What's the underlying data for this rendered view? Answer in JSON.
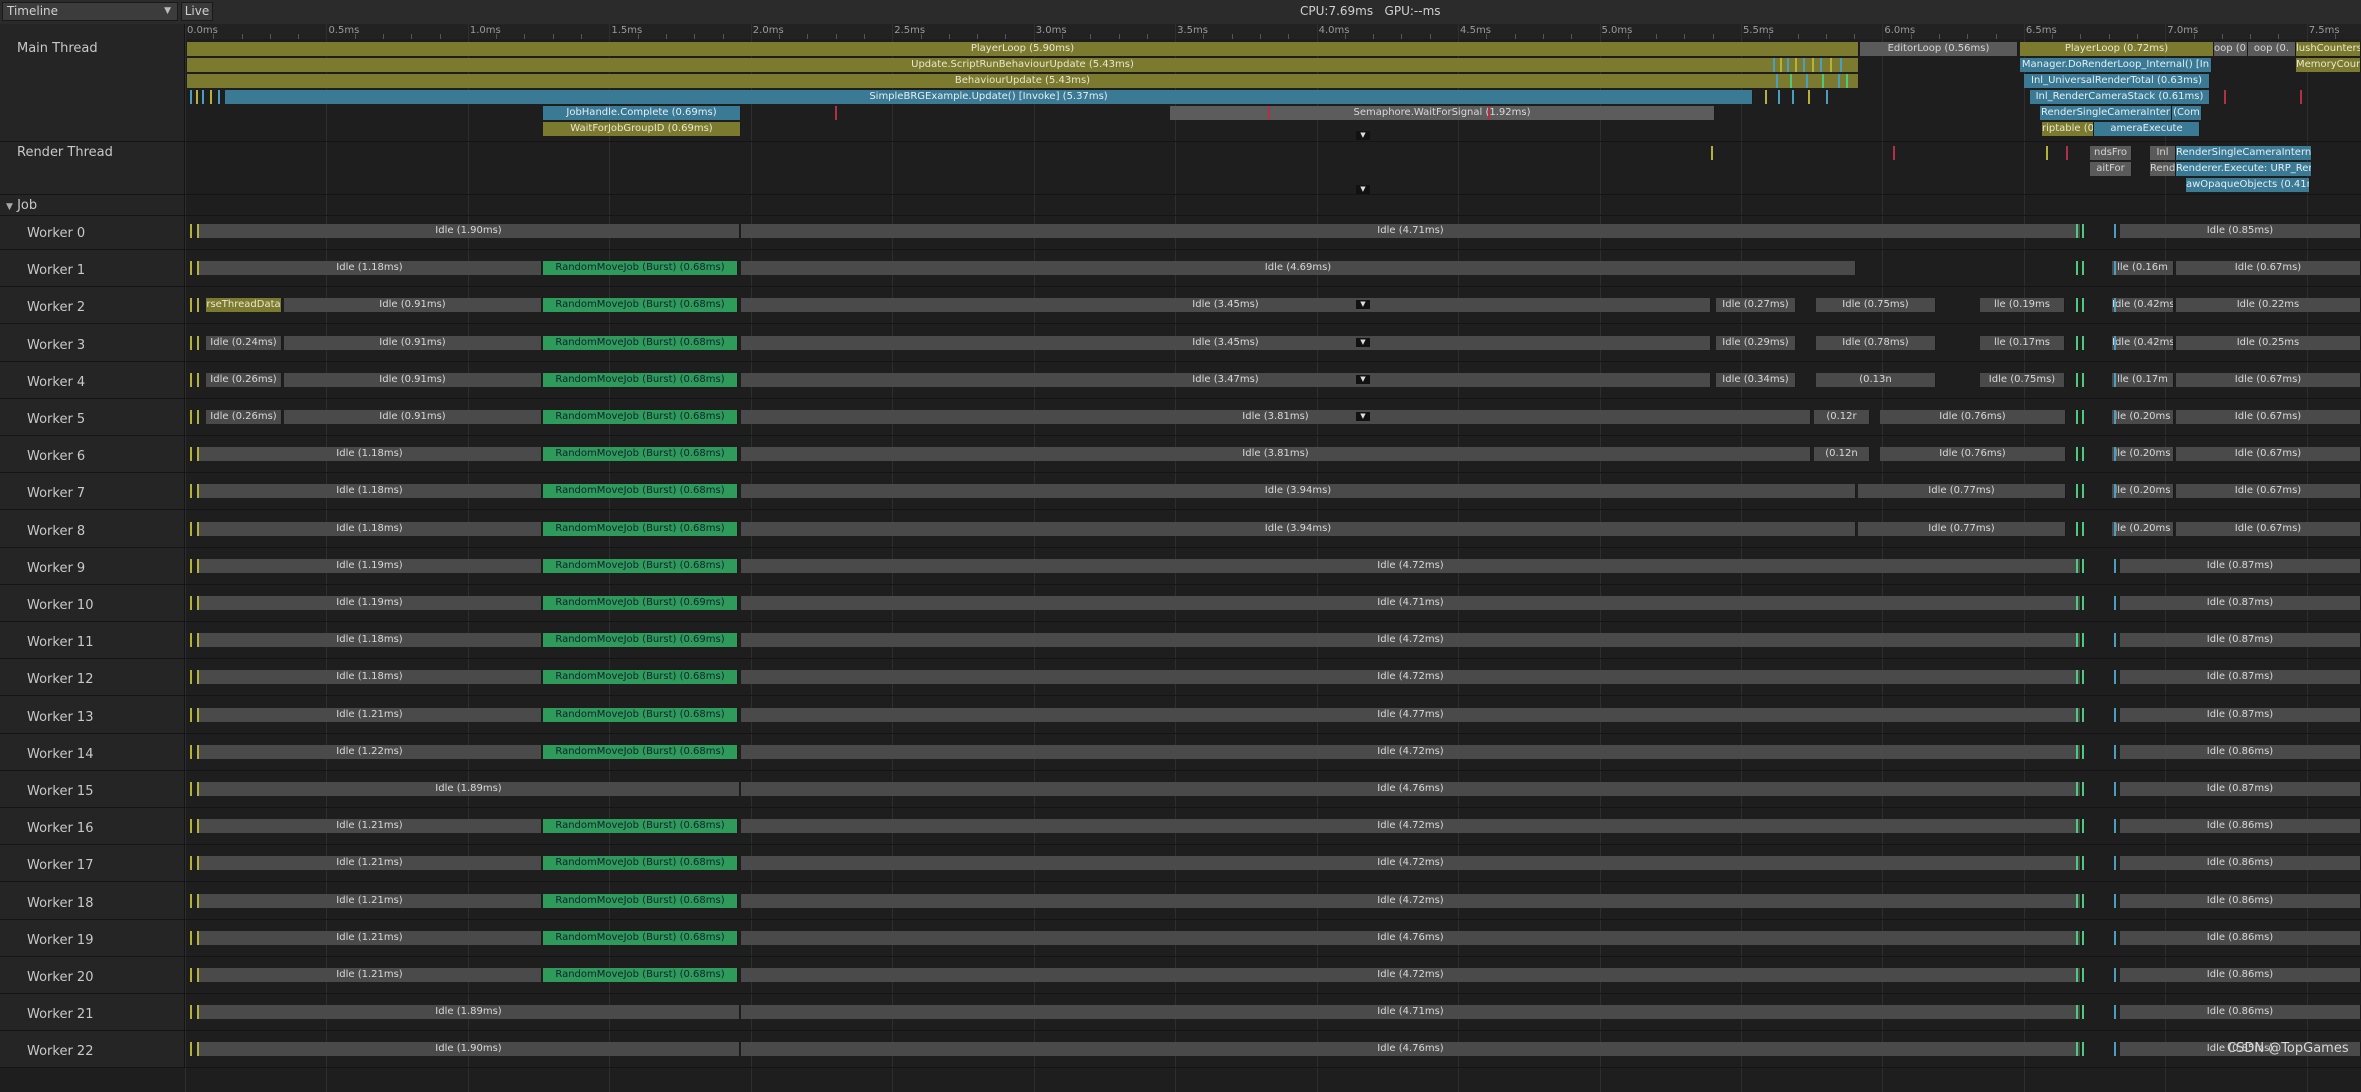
{
  "toolbar": {
    "view_select": "Timeline",
    "live_label": "Live",
    "cpu_gpu": "CPU:7.69ms   GPU:--ms"
  },
  "ruler": {
    "ticks": [
      "0.0ms",
      "0.5ms",
      "1.0ms",
      "1.5ms",
      "2.0ms",
      "2.5ms",
      "3.0ms",
      "3.5ms",
      "4.0ms",
      "4.5ms",
      "5.0ms",
      "5.5ms",
      "6.0ms",
      "6.5ms",
      "7.0ms",
      "7.5ms"
    ]
  },
  "threads": {
    "main": "Main Thread",
    "render": "Render Thread",
    "job_group": "Job"
  },
  "main_thread_markers": {
    "player_loop": "PlayerLoop (5.90ms)",
    "update_script": "Update.ScriptRunBehaviourUpdate (5.43ms)",
    "behaviour_update": "BehaviourUpdate (5.43ms)",
    "example_update": "SimpleBRGExample.Update() [Invoke] (5.37ms)",
    "job_complete": "JobHandle.Complete (0.69ms)",
    "wait_for_job": "WaitForJobGroupID (0.69ms)",
    "semaphore_wait": "Semaphore.WaitForSignal (1.92ms)",
    "editor_loop": "EditorLoop (0.56ms)",
    "player_loop_2": "PlayerLoop (0.72ms)",
    "frag_loop": "oop (0.",
    "frag_loop_2": "oop (0.",
    "flush_counters": "lushCounters",
    "render_loop_internal": "Manager.DoRenderLoop_Internal() [In",
    "memory_counters": "MemoryCoun",
    "urp_render_total": "Inl_UniversalRenderTotal (0.63ms)",
    "render_camera_stack": "Inl_RenderCameraStack (0.61ms)",
    "render_single_camera": "RenderSingleCameraInter",
    "frag_comp": "(Com",
    "scriptable": "riptable (0.",
    "frag_execute": "ameraExecute"
  },
  "render_thread_markers": {
    "frag_sends": "ndsFro",
    "frag_inl": "Inl",
    "render_single_internal": "RenderSingleCameraInterna",
    "frag_wait": "aitFor",
    "frag_rend": "Rend",
    "renderer_execute": "Renderer.Execute: URP_Rende",
    "opaque_objects": "awOpaqueObjects (0.41n"
  },
  "workers": [
    {
      "name": "Worker 0",
      "bars": [
        "Idle (1.90ms)",
        "Idle (4.71ms)",
        "Idle (0.85ms)"
      ]
    },
    {
      "name": "Worker 1",
      "bars": [
        "Idle (1.18ms)",
        "RandomMoveJob (Burst) (0.68ms)",
        "Idle (4.69ms)",
        "lle (0.16m",
        "Idle (0.67ms)"
      ]
    },
    {
      "name": "Worker 2",
      "bars": [
        "rseThreadData",
        "Idle (0.91ms)",
        "RandomMoveJob (Burst) (0.68ms)",
        "Idle (3.45ms)",
        "Idle (0.27ms)",
        "Idle (0.75ms)",
        "lle (0.19ms",
        "Idle (0.42ms)",
        "Idle (0.22ms"
      ]
    },
    {
      "name": "Worker 3",
      "bars": [
        "Idle (0.24ms)",
        "Idle (0.91ms)",
        "RandomMoveJob (Burst) (0.68ms)",
        "Idle (3.45ms)",
        "Idle (0.29ms)",
        "Idle (0.78ms)",
        "lle (0.17ms",
        "Idle (0.42ms)",
        "Idle (0.25ms"
      ]
    },
    {
      "name": "Worker 4",
      "bars": [
        "Idle (0.26ms)",
        "Idle (0.91ms)",
        "RandomMoveJob (Burst) (0.68ms)",
        "Idle (3.47ms)",
        "Idle (0.34ms)",
        "(0.13n",
        "Idle (0.75ms)",
        "lle (0.17m",
        "Idle (0.67ms)"
      ]
    },
    {
      "name": "Worker 5",
      "bars": [
        "Idle (0.26ms)",
        "Idle (0.91ms)",
        "RandomMoveJob (Burst) (0.68ms)",
        "Idle (3.81ms)",
        "(0.12r",
        "Idle (0.76ms)",
        "lle (0.20ms",
        "Idle (0.67ms)"
      ]
    },
    {
      "name": "Worker 6",
      "bars": [
        "Idle (1.18ms)",
        "RandomMoveJob (Burst) (0.68ms)",
        "Idle (3.81ms)",
        "(0.12n",
        "Idle (0.76ms)",
        "lle (0.20ms",
        "Idle (0.67ms)"
      ]
    },
    {
      "name": "Worker 7",
      "bars": [
        "Idle (1.18ms)",
        "RandomMoveJob (Burst) (0.68ms)",
        "Idle (3.94ms)",
        "Idle (0.77ms)",
        "lle (0.20ms",
        "Idle (0.67ms)"
      ]
    },
    {
      "name": "Worker 8",
      "bars": [
        "Idle (1.18ms)",
        "RandomMoveJob (Burst) (0.68ms)",
        "Idle (3.94ms)",
        "Idle (0.77ms)",
        "lle (0.20ms",
        "Idle (0.67ms)"
      ]
    },
    {
      "name": "Worker 9",
      "bars": [
        "Idle (1.19ms)",
        "RandomMoveJob (Burst) (0.68ms)",
        "Idle (4.72ms)",
        "Idle (0.87ms)"
      ]
    },
    {
      "name": "Worker 10",
      "bars": [
        "Idle (1.19ms)",
        "RandomMoveJob (Burst) (0.69ms)",
        "Idle (4.71ms)",
        "Idle (0.87ms)"
      ]
    },
    {
      "name": "Worker 11",
      "bars": [
        "Idle (1.18ms)",
        "RandomMoveJob (Burst) (0.69ms)",
        "Idle (4.72ms)",
        "Idle (0.87ms)"
      ]
    },
    {
      "name": "Worker 12",
      "bars": [
        "Idle (1.18ms)",
        "RandomMoveJob (Burst) (0.68ms)",
        "Idle (4.72ms)",
        "Idle (0.87ms)"
      ]
    },
    {
      "name": "Worker 13",
      "bars": [
        "Idle (1.21ms)",
        "RandomMoveJob (Burst) (0.68ms)",
        "Idle (4.77ms)",
        "Idle (0.87ms)"
      ]
    },
    {
      "name": "Worker 14",
      "bars": [
        "Idle (1.22ms)",
        "RandomMoveJob (Burst) (0.68ms)",
        "Idle (4.72ms)",
        "Idle (0.86ms)"
      ]
    },
    {
      "name": "Worker 15",
      "bars": [
        "Idle (1.89ms)",
        "Idle (4.76ms)",
        "Idle (0.87ms)"
      ]
    },
    {
      "name": "Worker 16",
      "bars": [
        "Idle (1.21ms)",
        "RandomMoveJob (Burst) (0.68ms)",
        "Idle (4.72ms)",
        "Idle (0.86ms)"
      ]
    },
    {
      "name": "Worker 17",
      "bars": [
        "Idle (1.21ms)",
        "RandomMoveJob (Burst) (0.68ms)",
        "Idle (4.72ms)",
        "Idle (0.86ms)"
      ]
    },
    {
      "name": "Worker 18",
      "bars": [
        "Idle (1.21ms)",
        "RandomMoveJob (Burst) (0.68ms)",
        "Idle (4.72ms)",
        "Idle (0.86ms)"
      ]
    },
    {
      "name": "Worker 19",
      "bars": [
        "Idle (1.21ms)",
        "RandomMoveJob (Burst) (0.68ms)",
        "Idle (4.76ms)",
        "Idle (0.86ms)"
      ]
    },
    {
      "name": "Worker 20",
      "bars": [
        "Idle (1.21ms)",
        "RandomMoveJob (Burst) (0.68ms)",
        "Idle (4.72ms)",
        "Idle (0.86ms)"
      ]
    },
    {
      "name": "Worker 21",
      "bars": [
        "Idle (1.89ms)",
        "Idle (4.71ms)",
        "Idle (0.86ms)"
      ]
    },
    {
      "name": "Worker 22",
      "bars": [
        "Idle (1.90ms)",
        "Idle (4.76ms)",
        "Idle (0.85ms)"
      ]
    }
  ],
  "watermark": "CSDN @TopGames",
  "colors": {
    "marker_olive": "#7b7a2e",
    "marker_blue": "#3b7a95",
    "job_green": "#2e9b5a",
    "idle_gray": "#4a4a4a"
  }
}
